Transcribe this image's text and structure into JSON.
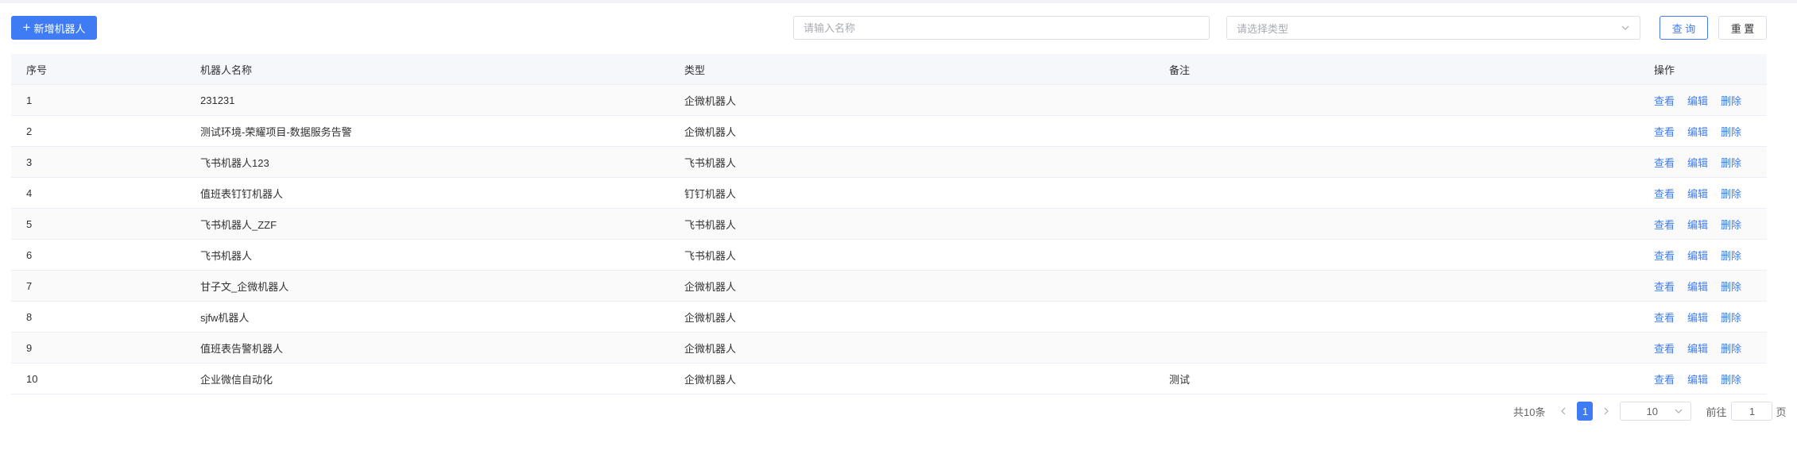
{
  "toolbar": {
    "add_label": "新增机器人",
    "name_placeholder": "请输入名称",
    "type_placeholder": "请选择类型",
    "query_label": "查 询",
    "reset_label": "重 置"
  },
  "table": {
    "headers": [
      "序号",
      "机器人名称",
      "类型",
      "备注",
      "操作"
    ],
    "actions": [
      "查看",
      "编辑",
      "删除"
    ],
    "rows": [
      {
        "index": "1",
        "name": "231231",
        "type": "企微机器人",
        "remark": ""
      },
      {
        "index": "2",
        "name": "测试环境-荣耀项目-数据服务告警",
        "type": "企微机器人",
        "remark": ""
      },
      {
        "index": "3",
        "name": "飞书机器人123",
        "type": "飞书机器人",
        "remark": ""
      },
      {
        "index": "4",
        "name": "值班表钉钉机器人",
        "type": "钉钉机器人",
        "remark": ""
      },
      {
        "index": "5",
        "name": "飞书机器人_ZZF",
        "type": "飞书机器人",
        "remark": ""
      },
      {
        "index": "6",
        "name": "飞书机器人",
        "type": "飞书机器人",
        "remark": ""
      },
      {
        "index": "7",
        "name": "甘子文_企微机器人",
        "type": "企微机器人",
        "remark": ""
      },
      {
        "index": "8",
        "name": "sjfw机器人",
        "type": "企微机器人",
        "remark": ""
      },
      {
        "index": "9",
        "name": "值班表告警机器人",
        "type": "企微机器人",
        "remark": ""
      },
      {
        "index": "10",
        "name": "企业微信自动化",
        "type": "企微机器人",
        "remark": "测试"
      }
    ]
  },
  "pagination": {
    "total_label": "共10条",
    "current_page": "1",
    "page_size": "10",
    "goto_label": "前往",
    "goto_value": "1",
    "page_unit": "页"
  },
  "colors": {
    "primary": "#3f7cf3",
    "border": "#dcdfe6",
    "header_bg": "#f5f7fa"
  }
}
